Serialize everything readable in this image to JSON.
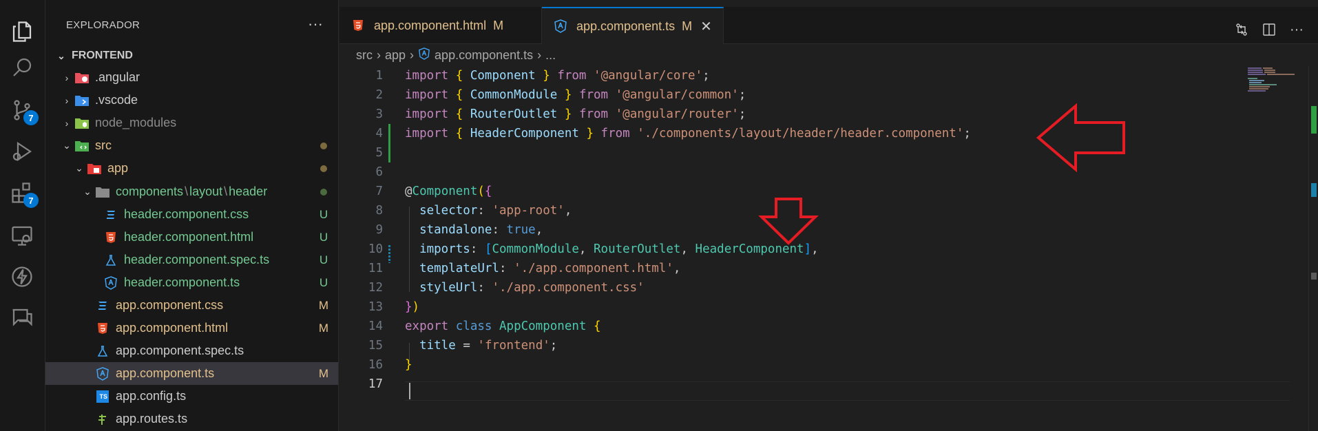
{
  "activity_bar": {
    "items": [
      {
        "name": "explorer-icon",
        "badge": ""
      },
      {
        "name": "search-icon",
        "badge": ""
      },
      {
        "name": "source-control-icon",
        "badge": "7"
      },
      {
        "name": "run-debug-icon",
        "badge": ""
      },
      {
        "name": "extensions-icon",
        "badge": "7"
      },
      {
        "name": "remote-explorer-icon",
        "badge": ""
      },
      {
        "name": "lightning-icon",
        "badge": ""
      },
      {
        "name": "chat-icon",
        "badge": ""
      }
    ]
  },
  "sidebar": {
    "title": "EXPLORADOR",
    "more": "···",
    "section": "FRONTEND",
    "tree": [
      {
        "label": ".angular",
        "deco": "",
        "icon": "angular-folder-icon"
      },
      {
        "label": ".vscode",
        "deco": "",
        "icon": "vscode-folder-icon"
      },
      {
        "label": "node_modules",
        "deco": "",
        "icon": "node-folder-icon"
      },
      {
        "label": "src",
        "deco": "",
        "icon": "src-folder-icon"
      },
      {
        "label": "app",
        "deco": "",
        "icon": "app-folder-icon"
      },
      {
        "label": "components",
        "label2": "layout",
        "label3": "header",
        "deco": "",
        "icon": "folder-icon"
      },
      {
        "label": "header.component.css",
        "deco": "U",
        "icon": "css-file-icon"
      },
      {
        "label": "header.component.html",
        "deco": "U",
        "icon": "html-file-icon"
      },
      {
        "label": "header.component.spec.ts",
        "deco": "U",
        "icon": "test-file-icon"
      },
      {
        "label": "header.component.ts",
        "deco": "U",
        "icon": "angular-file-icon"
      },
      {
        "label": "app.component.css",
        "deco": "M",
        "icon": "css-file-icon"
      },
      {
        "label": "app.component.html",
        "deco": "M",
        "icon": "html-file-icon"
      },
      {
        "label": "app.component.spec.ts",
        "deco": "",
        "icon": "test-file-icon"
      },
      {
        "label": "app.component.ts",
        "deco": "M",
        "icon": "angular-file-icon"
      },
      {
        "label": "app.config.ts",
        "deco": "",
        "icon": "ts-file-icon"
      },
      {
        "label": "app.routes.ts",
        "deco": "",
        "icon": "routes-file-icon"
      }
    ]
  },
  "tabs": [
    {
      "label": "app.component.html",
      "mod": "M"
    },
    {
      "label": "app.component.ts",
      "mod": "M",
      "close": "✕"
    }
  ],
  "breadcrumb": [
    "src",
    "app",
    "app.component.ts",
    "..."
  ],
  "code": {
    "line_numbers": [
      "1",
      "2",
      "3",
      "4",
      "5",
      "6",
      "7",
      "8",
      "9",
      "10",
      "11",
      "12",
      "13",
      "14",
      "15",
      "16",
      "17"
    ],
    "l1": {
      "kw": "import",
      "b1": "{",
      "c": "Component",
      "b2": "}",
      "from": "from",
      "s": "'@angular/core'",
      "e": ";"
    },
    "l2": {
      "kw": "import",
      "b1": "{",
      "c": "CommonModule",
      "b2": "}",
      "from": "from",
      "s": "'@angular/common'",
      "e": ";"
    },
    "l3": {
      "kw": "import",
      "b1": "{",
      "c": "RouterOutlet",
      "b2": "}",
      "from": "from",
      "s": "'@angular/router'",
      "e": ";"
    },
    "l4": {
      "kw": "import",
      "b1": "{",
      "c": "HeaderComponent",
      "b2": "}",
      "from": "from",
      "s": "'./components/layout/header/header.component'",
      "e": ";"
    },
    "l7": {
      "at": "@",
      "dec": "Component",
      "p": "(",
      "b": "{"
    },
    "l8": {
      "k": "selector",
      "c": ":",
      "s": "'app-root'",
      "e": ","
    },
    "l9": {
      "k": "standalone",
      "c": ":",
      "v": "true",
      "e": ","
    },
    "l10": {
      "k": "imports",
      "c": ":",
      "b1": "[",
      "a": "CommonModule",
      "s1": ",",
      "b": "RouterOutlet",
      "s2": ",",
      "cc": "HeaderComponent",
      "b2": "]",
      "e": ","
    },
    "l11": {
      "k": "templateUrl",
      "c": ":",
      "s": "'./app.component.html'",
      "e": ","
    },
    "l12": {
      "k": "styleUrl",
      "c": ":",
      "s": "'./app.component.css'"
    },
    "l13": {
      "b": "}",
      "p": ")"
    },
    "l14": {
      "kw": "export",
      "kw2": "class",
      "c": "AppComponent",
      "b": "{"
    },
    "l15": {
      "k": "title",
      "eq": "=",
      "s": "'frontend'",
      "e": ";"
    },
    "l16": {
      "b": "}"
    }
  },
  "annotations": {
    "arrow_color": "#e51c23"
  }
}
